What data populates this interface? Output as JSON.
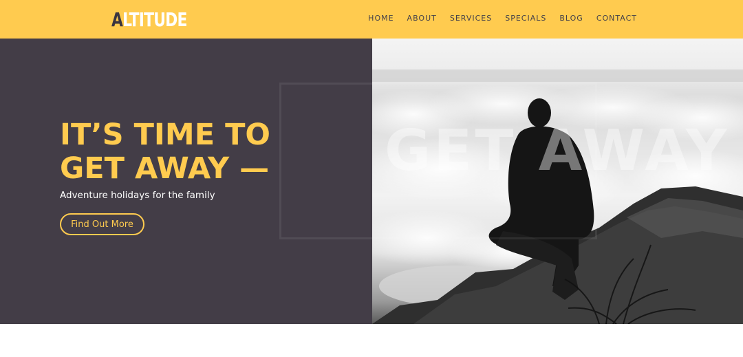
{
  "brand": {
    "logo_first": "A",
    "logo_rest": "LTITUDE"
  },
  "nav": {
    "items": [
      "HOME",
      "ABOUT",
      "SERVICES",
      "SPECIALS",
      "BLOG",
      "CONTACT"
    ]
  },
  "hero": {
    "title_line1": "IT’S TIME TO",
    "title_line2": "GET AWAY —",
    "subtitle": "Adventure holidays for the family",
    "cta_label": "Find Out More",
    "watermark": "GET AWAY"
  },
  "colors": {
    "accent": "#ffcb4f",
    "dark_panel": "#433d47",
    "nav_text": "#45404a"
  }
}
